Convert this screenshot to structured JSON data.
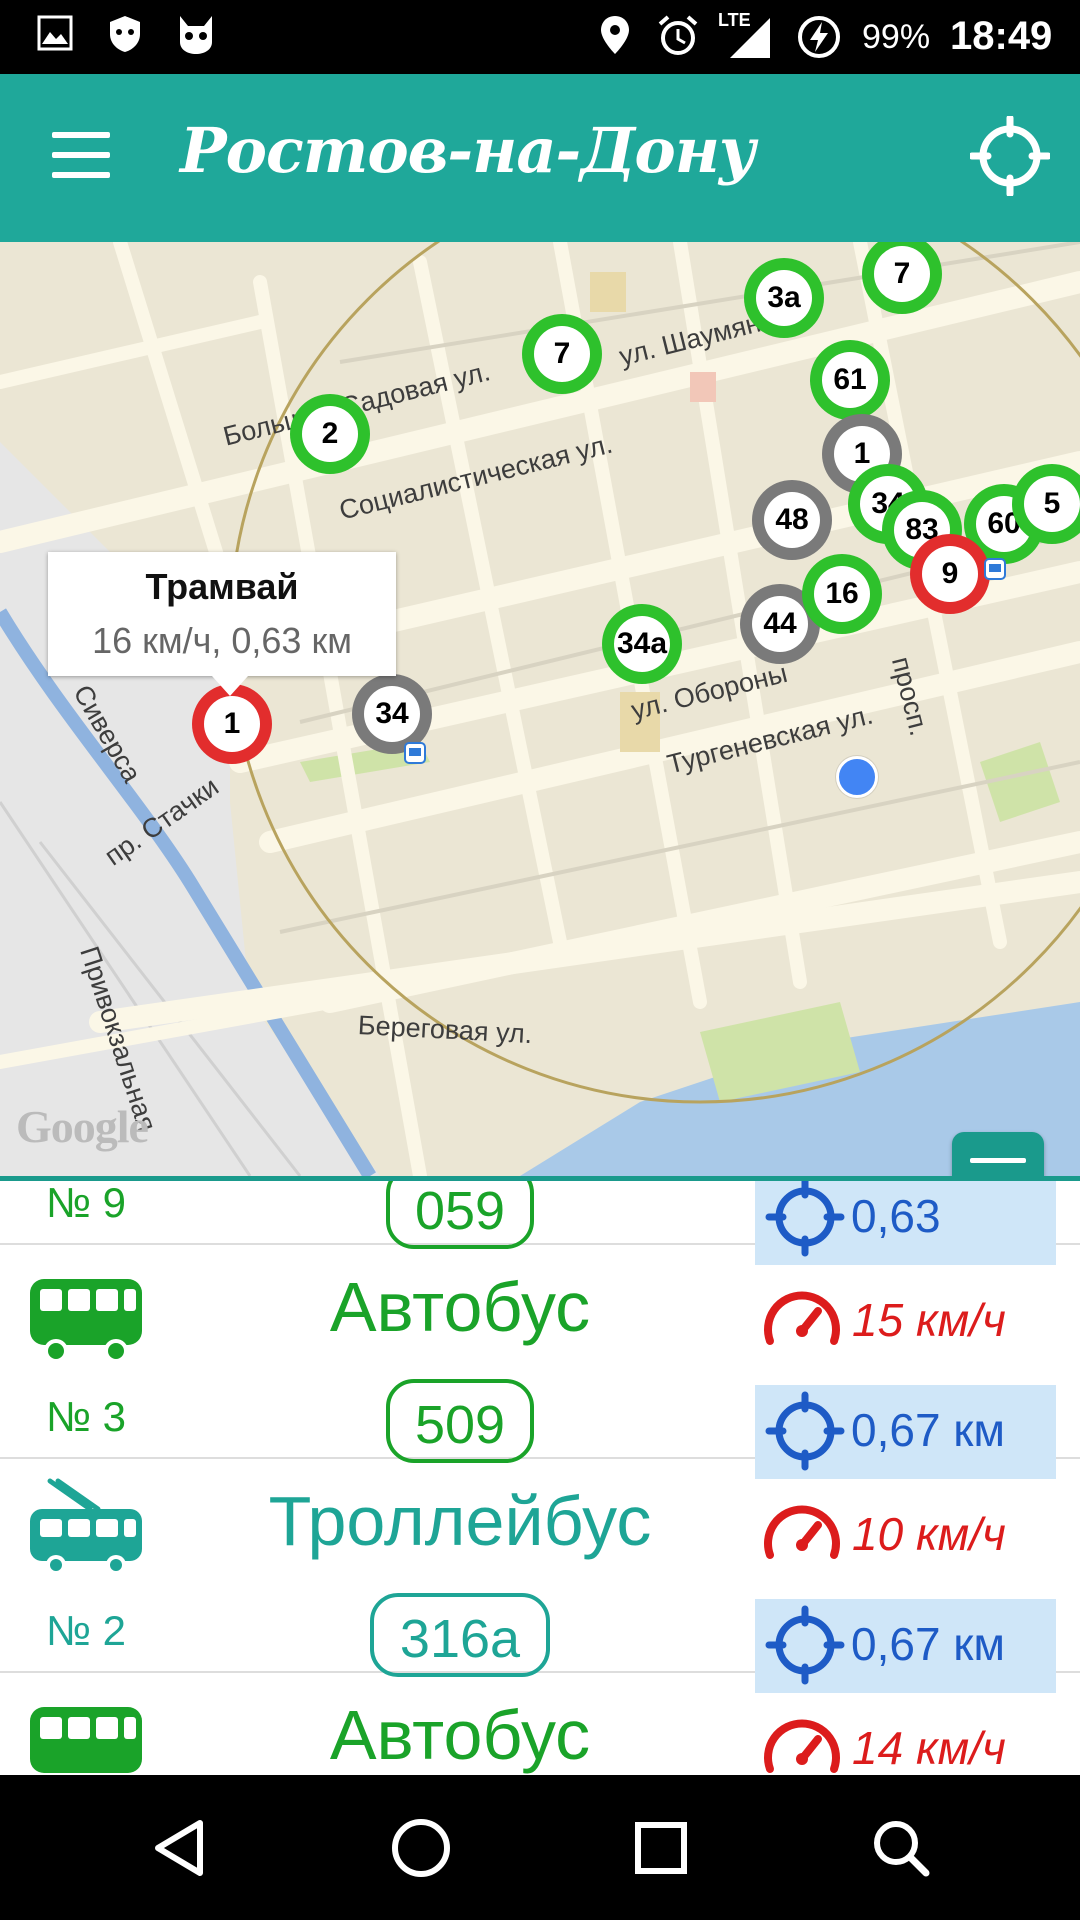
{
  "status_bar": {
    "battery": "99%",
    "network": "LTE",
    "time": "18:49"
  },
  "toolbar": {
    "title": "Ростов-на-Дону",
    "menu_icon": "hamburger-menu-icon",
    "locate_icon": "crosshair-locate-icon"
  },
  "map": {
    "streets": [
      "Большая Садовая ул.",
      "ул. Шаумяна",
      "Социалистическая ул.",
      "ул. Обороны",
      "Тургеневская ул.",
      "просп.",
      "Сиверса",
      "пр. Стачки",
      "Привокзальная",
      "Береговая ул."
    ],
    "logo": "Google",
    "info_window": {
      "title": "Трамвай",
      "subtitle": "16 км/ч, 0,63 км"
    },
    "markers": [
      "3а",
      "7",
      "7",
      "61",
      "2",
      "48",
      "1",
      "34",
      "83",
      "60",
      "9",
      "44",
      "16",
      "34а",
      "1",
      "34",
      "5"
    ],
    "colors": {
      "green": "#2ec12c",
      "gray": "#7a7a7a",
      "red": "#e22d2d",
      "radius": "#b8a35e",
      "water": "#a9c9e8"
    }
  },
  "list": [
    {
      "number": "№ 9",
      "type": "",
      "route": "059",
      "speed": "",
      "distance": "0,63",
      "color": "#1aa329",
      "icon": "bus-icon"
    },
    {
      "number": "№ 3",
      "type": "Автобус",
      "route": "509",
      "speed": "15 км/ч",
      "distance": "0,67 км",
      "color": "#1aa329",
      "icon": "bus-icon"
    },
    {
      "number": "№ 2",
      "type": "Троллейбус",
      "route": "316а",
      "speed": "10 км/ч",
      "distance": "0,67 км",
      "color": "#1ea596",
      "icon": "trolleybus-icon"
    },
    {
      "number": "",
      "type": "Автобус",
      "route": "",
      "speed": "14 км/ч",
      "distance": "",
      "color": "#1aa329",
      "icon": "bus-icon"
    }
  ],
  "colors": {
    "accent": "#1fa89a",
    "speed": "#dc1c1c",
    "distance": "#1e5bc6",
    "distance_bg": "#cfe6f8"
  },
  "navigation": {
    "back": "back-triangle-icon",
    "home": "home-circle-icon",
    "recents": "recents-square-icon",
    "search": "search-icon"
  }
}
